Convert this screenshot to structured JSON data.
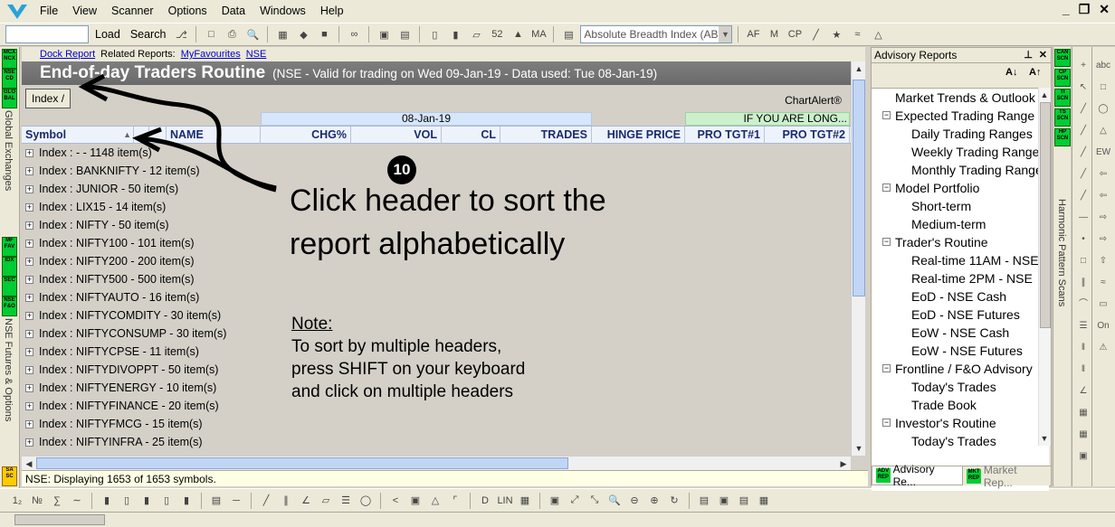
{
  "menu": {
    "items": [
      "File",
      "View",
      "Scanner",
      "Options",
      "Data",
      "Windows",
      "Help"
    ],
    "window_controls": [
      "_",
      "❐",
      "✕"
    ]
  },
  "toolbar": {
    "load_label": "Load",
    "search_label": "Search",
    "indicator_select": "Absolute Breadth Index (ABI"
  },
  "left_panel": {
    "buttons": [
      "MCX NCX",
      "NSE CD",
      "GLO BAL",
      "MF FAV",
      "IDX",
      "SEC",
      "NSE F&O",
      "SA SC"
    ],
    "labels": [
      "Global Exchanges",
      "NSE Futures & Options"
    ]
  },
  "report": {
    "links": {
      "dock": "Dock Report",
      "related_label": "Related Reports:",
      "favourites": "MyFavourites",
      "nse": "NSE"
    },
    "title": "End-of-day Traders Routine",
    "subtitle": "(NSE - Valid for trading on Wed 09-Jan-19 - Data used: Tue 08-Jan-19)",
    "index_button": "Index /",
    "chartalert": "ChartAlert®",
    "date_group": "08-Jan-19",
    "long_group": "IF YOU ARE LONG...",
    "columns": [
      "Symbol",
      "NAME",
      "CHG%",
      "VOL",
      "CL",
      "TRADES",
      "HINGE PRICE",
      "PRO TGT#1",
      "PRO TGT#2"
    ],
    "rows": [
      "Index : - - 1148 item(s)",
      "Index : BANKNIFTY - 12 item(s)",
      "Index : JUNIOR - 50 item(s)",
      "Index : LIX15 - 14 item(s)",
      "Index : NIFTY - 50 item(s)",
      "Index : NIFTY100 - 101 item(s)",
      "Index : NIFTY200 - 200 item(s)",
      "Index : NIFTY500 - 500 item(s)",
      "Index : NIFTYAUTO - 16 item(s)",
      "Index : NIFTYCOMDITY - 30 item(s)",
      "Index : NIFTYCONSUMP - 30 item(s)",
      "Index : NIFTYCPSE - 11 item(s)",
      "Index : NIFTYDIVOPPT - 50 item(s)",
      "Index : NIFTYENERGY - 10 item(s)",
      "Index : NIFTYFINANCE - 20 item(s)",
      "Index : NIFTYFMCG - 15 item(s)",
      "Index : NIFTYINFRA - 25 item(s)"
    ]
  },
  "annotation": {
    "step_number": "10",
    "main_text_line1": "Click header to sort the",
    "main_text_line2": "report alphabetically",
    "note_title": "Note:",
    "note_line1": "To sort by multiple headers,",
    "note_line2": "press SHIFT on your keyboard",
    "note_line3": "and click on multiple headers"
  },
  "status": {
    "text": "NSE: Displaying 1653 of 1653 symbols."
  },
  "advisory": {
    "title": "Advisory Reports",
    "tree": [
      {
        "label": "Market Trends & Outlook",
        "level": 0,
        "box": false
      },
      {
        "label": "Expected Trading Range",
        "level": 0,
        "box": true
      },
      {
        "label": "Daily Trading Ranges",
        "level": 1,
        "box": false
      },
      {
        "label": "Weekly Trading Ranges",
        "level": 1,
        "box": false
      },
      {
        "label": "Monthly Trading Ranges",
        "level": 1,
        "box": false
      },
      {
        "label": "Model Portfolio",
        "level": 0,
        "box": true
      },
      {
        "label": "Short-term",
        "level": 1,
        "box": false
      },
      {
        "label": "Medium-term",
        "level": 1,
        "box": false
      },
      {
        "label": "Trader's Routine",
        "level": 0,
        "box": true
      },
      {
        "label": "Real-time 11AM - NSE",
        "level": 1,
        "box": false
      },
      {
        "label": "Real-time 2PM - NSE",
        "level": 1,
        "box": false
      },
      {
        "label": "EoD - NSE Cash",
        "level": 1,
        "box": false
      },
      {
        "label": "EoD - NSE Futures",
        "level": 1,
        "box": false
      },
      {
        "label": "EoW - NSE Cash",
        "level": 1,
        "box": false
      },
      {
        "label": "EoW - NSE Futures",
        "level": 1,
        "box": false
      },
      {
        "label": "Frontline / F&O Advisory",
        "level": 0,
        "box": true
      },
      {
        "label": "Today's Trades",
        "level": 1,
        "box": false
      },
      {
        "label": "Trade Book",
        "level": 1,
        "box": false
      },
      {
        "label": "Investor's Routine",
        "level": 0,
        "box": true
      },
      {
        "label": "Today's Trades",
        "level": 1,
        "box": false
      }
    ],
    "tab_advisory": "Advisory Re...",
    "tab_market": "Market Rep..."
  },
  "right_strip": {
    "buttons": [
      "CAN SCN",
      "CP SCN",
      "TI SCN",
      "TS SCN",
      "HP SCN"
    ],
    "label": "Harmonic Pattern Scans"
  },
  "colors": {
    "accent_green": "#00cc33",
    "title_bar": "#6e6e6e",
    "link_blue": "#0000cc",
    "header_text": "#1a2a6c"
  }
}
